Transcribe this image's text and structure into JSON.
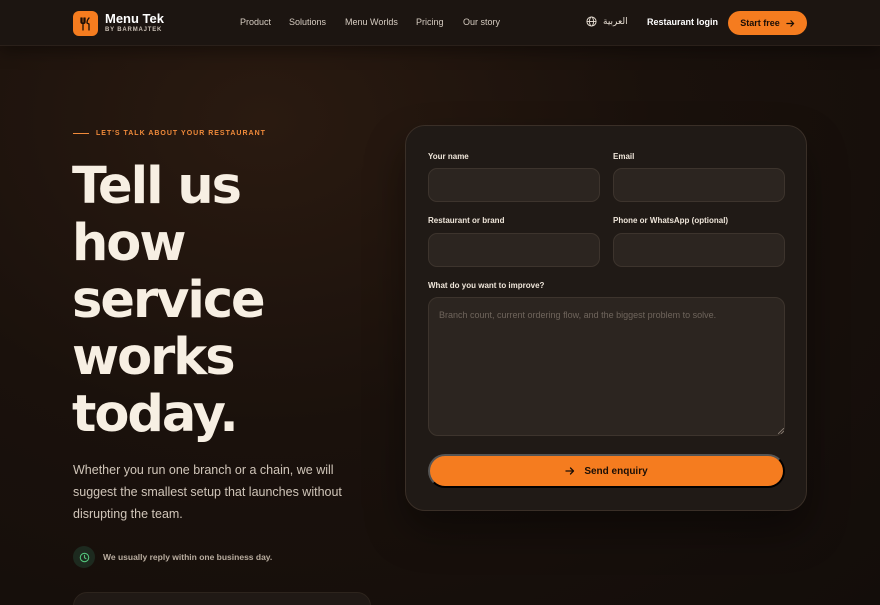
{
  "brand": {
    "name": "Menu Tek",
    "subtitle": "BY BARMAJTEK"
  },
  "nav": {
    "items": [
      "Product",
      "Solutions",
      "Menu Worlds",
      "Pricing",
      "Our story"
    ],
    "language": "العربية",
    "login": "Restaurant login",
    "cta": "Start free"
  },
  "hero": {
    "eyebrow": "LET'S TALK ABOUT YOUR RESTAURANT",
    "title_lines": [
      "Tell us",
      "how",
      "service",
      "works",
      "today."
    ],
    "description": "Whether you run one branch or a chain, we will suggest the smallest setup that launches without disrupting the team.",
    "reply_note": "We usually reply within one business day."
  },
  "form": {
    "name_label": "Your name",
    "email_label": "Email",
    "restaurant_label": "Restaurant or brand",
    "phone_label": "Phone or WhatsApp (optional)",
    "improve_label": "What do you want to improve?",
    "improve_placeholder": "Branch count, current ordering flow, and the biggest problem to solve.",
    "name_value": "",
    "email_value": "",
    "restaurant_value": "",
    "phone_value": "",
    "submit_label": "Send enquiry"
  },
  "colors": {
    "accent": "#f57c1f",
    "background": "#1a110c",
    "card": "#201a16"
  }
}
